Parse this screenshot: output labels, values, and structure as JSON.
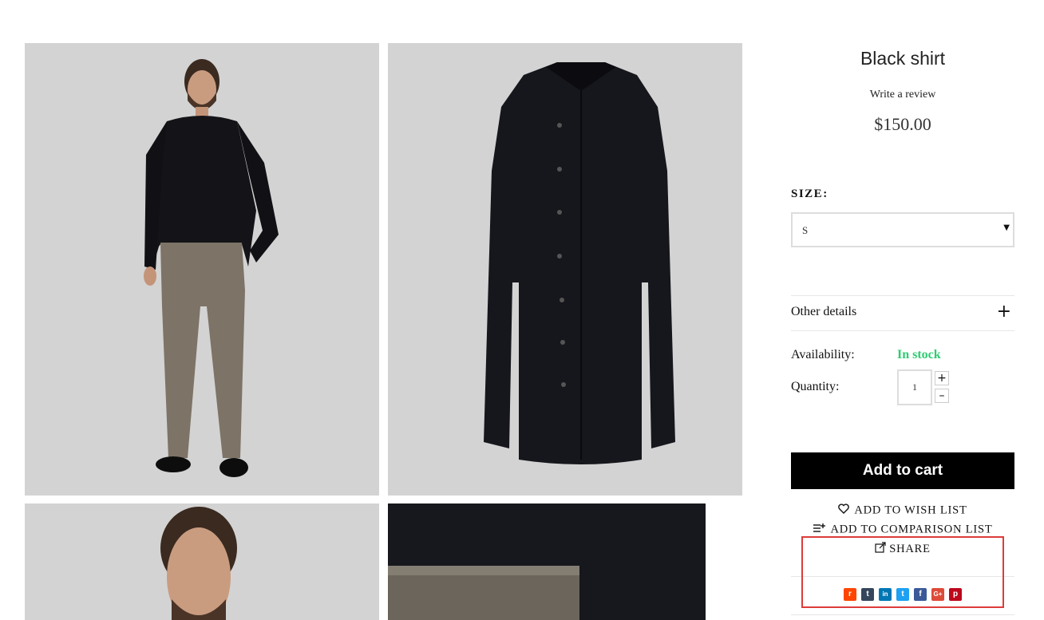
{
  "product": {
    "title": "Black shirt",
    "review_link": "Write a review",
    "price": "$150.00"
  },
  "size": {
    "label": "SIZE:",
    "selected": "S"
  },
  "details": {
    "label": "Other details",
    "toggle_icon": "plus-icon"
  },
  "availability": {
    "label": "Availability:",
    "value": "In stock",
    "value_color": "#2ecc71"
  },
  "quantity": {
    "label": "Quantity:",
    "value": "1",
    "increment": "+",
    "decrement": "–"
  },
  "actions": {
    "add_to_cart": "Add to cart",
    "wish_list": "ADD TO WISH LIST",
    "comparison_list": "ADD TO COMPARISON LIST",
    "share": "SHARE"
  },
  "social": [
    {
      "name": "reddit",
      "glyph": "r",
      "color": "#ff4500"
    },
    {
      "name": "tumblr",
      "glyph": "t",
      "color": "#35465c"
    },
    {
      "name": "linkedin",
      "glyph": "in",
      "color": "#0077b5"
    },
    {
      "name": "twitter",
      "glyph": "t",
      "color": "#1da1f2"
    },
    {
      "name": "facebook",
      "glyph": "f",
      "color": "#3b5998"
    },
    {
      "name": "google-plus",
      "glyph": "G+",
      "color": "#dd4b39"
    },
    {
      "name": "pinterest",
      "glyph": "p",
      "color": "#bd081c"
    }
  ],
  "colors": {
    "image_bg": "#d3d3d3",
    "cart_button": "#000000",
    "highlight_box": "#dd3b3b"
  }
}
